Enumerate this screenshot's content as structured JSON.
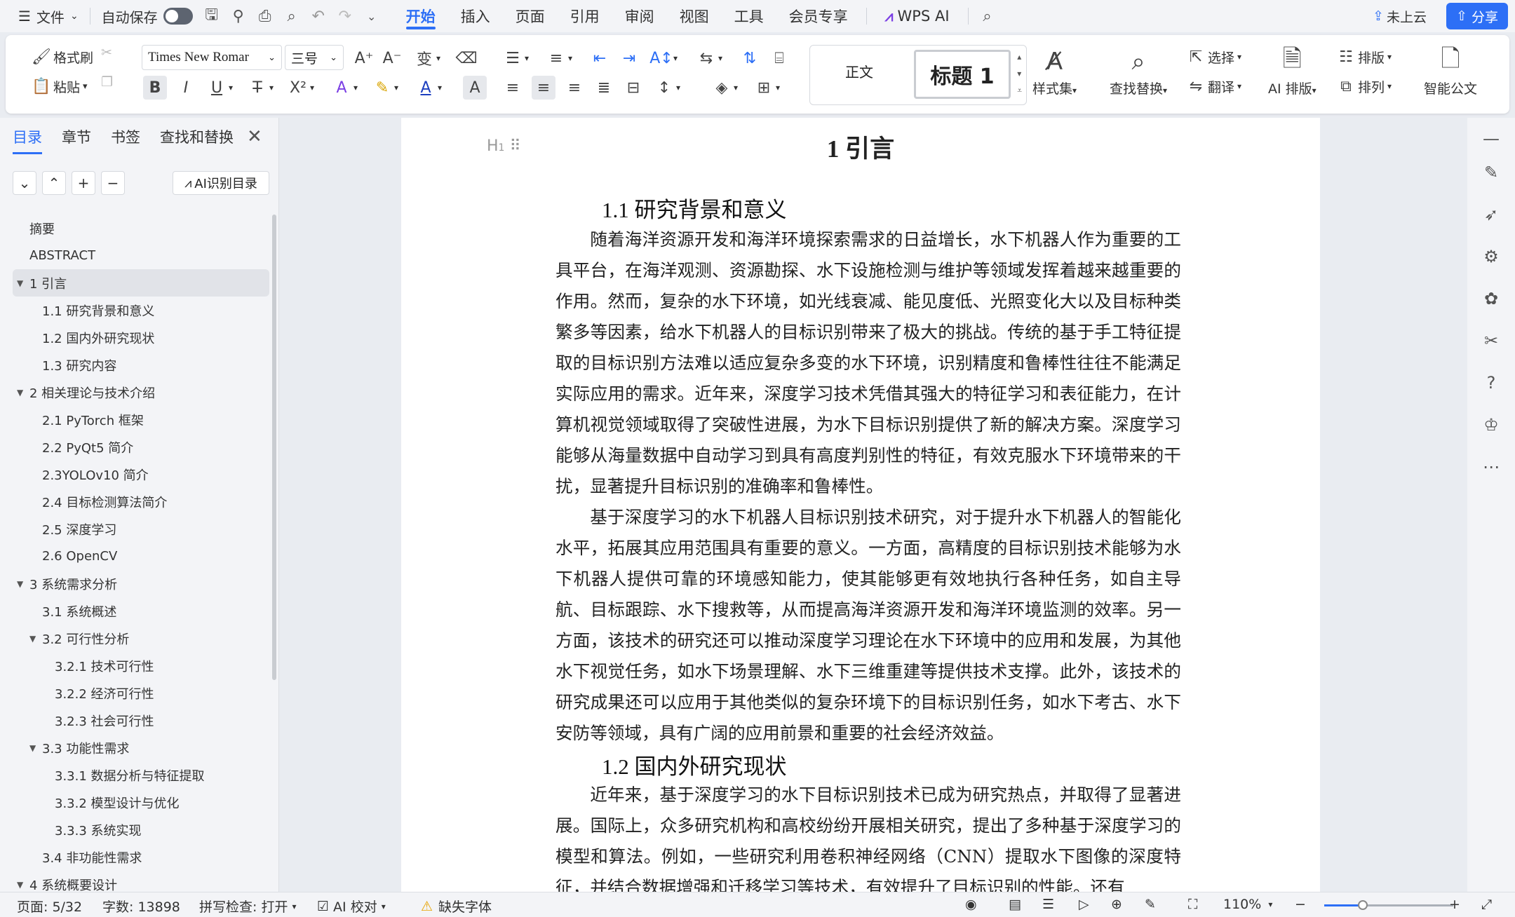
{
  "menubar": {
    "file": "文件",
    "autosave": "自动保存",
    "tabs": [
      "开始",
      "插入",
      "页面",
      "引用",
      "审阅",
      "视图",
      "工具",
      "会员专享"
    ],
    "wps_ai": "WPS AI",
    "cloud": "未上云",
    "share": "分享"
  },
  "ribbon": {
    "format_painter": "格式刷",
    "paste": "粘贴",
    "font_name": "Times New Romar",
    "font_size": "三号",
    "style_normal": "正文",
    "style_heading1": "标题 1",
    "styles_set": "样式集",
    "find_replace": "查找替换",
    "select": "选择",
    "translate": "翻译",
    "ai_layout": "AI 排版",
    "typeset": "排版",
    "arrange": "排列",
    "smart_doc": "智能公文"
  },
  "sidebar": {
    "tabs": [
      "目录",
      "章节",
      "书签",
      "查找和替换"
    ],
    "ai_toc": "AI识别目录",
    "toc": [
      {
        "label": "摘要",
        "level": 1,
        "arrow": ""
      },
      {
        "label": "ABSTRACT",
        "level": 1,
        "arrow": ""
      },
      {
        "label": "1  引言",
        "level": 1,
        "arrow": "▼",
        "selected": true
      },
      {
        "label": "1.1  研究背景和意义",
        "level": 2,
        "arrow": ""
      },
      {
        "label": "1.2  国内外研究现状",
        "level": 2,
        "arrow": ""
      },
      {
        "label": "1.3  研究内容",
        "level": 2,
        "arrow": ""
      },
      {
        "label": "2  相关理论与技术介绍",
        "level": 1,
        "arrow": "▼"
      },
      {
        "label": "2.1 PyTorch 框架",
        "level": 2,
        "arrow": ""
      },
      {
        "label": "2.2 PyQt5 简介",
        "level": 2,
        "arrow": ""
      },
      {
        "label": "2.3YOLOv10 简介",
        "level": 2,
        "arrow": ""
      },
      {
        "label": "2.4 目标检测算法简介",
        "level": 2,
        "arrow": ""
      },
      {
        "label": "2.5  深度学习",
        "level": 2,
        "arrow": ""
      },
      {
        "label": "2.6 OpenCV",
        "level": 2,
        "arrow": ""
      },
      {
        "label": "3  系统需求分析",
        "level": 1,
        "arrow": "▼"
      },
      {
        "label": "3.1  系统概述",
        "level": 2,
        "arrow": ""
      },
      {
        "label": "3.2  可行性分析",
        "level": 2,
        "arrow": "▼"
      },
      {
        "label": "3.2.1  技术可行性",
        "level": 3,
        "arrow": ""
      },
      {
        "label": "3.2.2  经济可行性",
        "level": 3,
        "arrow": ""
      },
      {
        "label": "3.2.3  社会可行性",
        "level": 3,
        "arrow": ""
      },
      {
        "label": "3.3  功能性需求",
        "level": 2,
        "arrow": "▼"
      },
      {
        "label": "3.3.1  数据分析与特征提取",
        "level": 3,
        "arrow": ""
      },
      {
        "label": "3.3.2  模型设计与优化",
        "level": 3,
        "arrow": ""
      },
      {
        "label": "3.3.3  系统实现",
        "level": 3,
        "arrow": ""
      },
      {
        "label": "3.4  非功能性需求",
        "level": 2,
        "arrow": ""
      },
      {
        "label": "4  系统概要设计",
        "level": 1,
        "arrow": "▼"
      }
    ]
  },
  "document": {
    "title": "1  引言",
    "h2_1": "1.1  研究背景和意义",
    "p1": "随着海洋资源开发和海洋环境探索需求的日益增长，水下机器人作为重要的工具平台，在海洋观测、资源勘探、水下设施检测与维护等领域发挥着越来越重要的作用。然而，复杂的水下环境，如光线衰减、能见度低、光照变化大以及目标种类繁多等因素，给水下机器人的目标识别带来了极大的挑战。传统的基于手工特征提取的目标识别方法难以适应复杂多变的水下环境，识别精度和鲁棒性往往不能满足实际应用的需求。近年来，深度学习技术凭借其强大的特征学习和表征能力，在计算机视觉领域取得了突破性进展，为水下目标识别提供了新的解决方案。深度学习能够从海量数据中自动学习到具有高度判别性的特征，有效克服水下环境带来的干扰，显著提升目标识别的准确率和鲁棒性。",
    "p2": "基于深度学习的水下机器人目标识别技术研究，对于提升水下机器人的智能化水平，拓展其应用范围具有重要的意义。一方面，高精度的目标识别技术能够为水下机器人提供可靠的环境感知能力，使其能够更有效地执行各种任务，如自主导航、目标跟踪、水下搜救等，从而提高海洋资源开发和海洋环境监测的效率。另一方面，该技术的研究还可以推动深度学习理论在水下环境中的应用和发展，为其他水下视觉任务，如水下场景理解、水下三维重建等提供技术支撑。此外，该技术的研究成果还可以应用于其他类似的复杂环境下的目标识别任务，如水下考古、水下安防等领域，具有广阔的应用前景和重要的社会经济效益。",
    "h2_2": "1.2  国内外研究现状",
    "p3": "近年来，基于深度学习的水下目标识别技术已成为研究热点，并取得了显著进展。国际上，众多研究机构和高校纷纷开展相关研究，提出了多种基于深度学习的模型和算法。例如，一些研究利用卷积神经网络（CNN）提取水下图像的深度特征，并结合数据增强和迁移学习等技术，有效提升了目标识别的性能。还有"
  },
  "status": {
    "page": "页面: 5/32",
    "words": "字数: 13898",
    "spell": "拼写检查: 打开",
    "ai_check": "AI 校对",
    "missing_font": "缺失字体",
    "zoom": "110%",
    "zoom_level": 0.3
  },
  "colors": {
    "accent": "#2d6ff6",
    "ai_purple": "#7b3fe4"
  }
}
